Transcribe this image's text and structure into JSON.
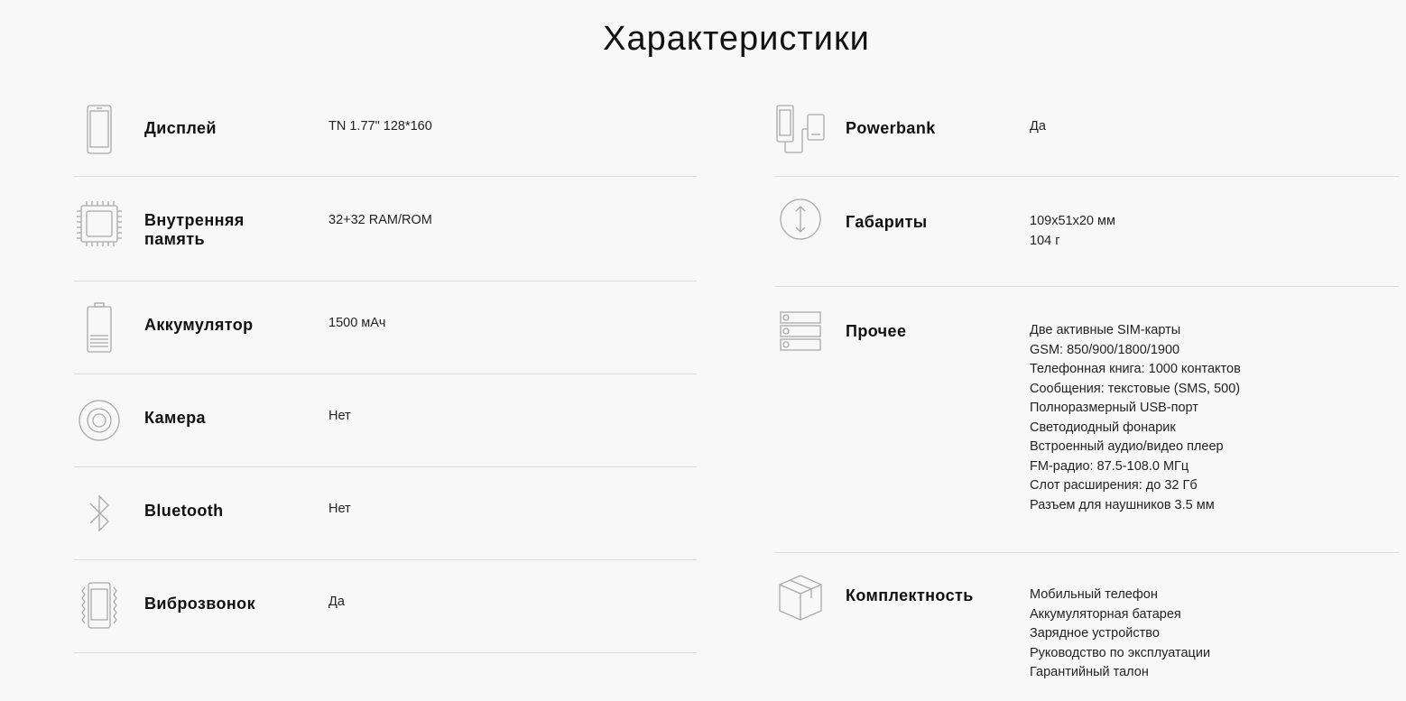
{
  "page": {
    "title": "Характеристики"
  },
  "left_specs": [
    {
      "icon": "phone-icon",
      "label": "Дисплей",
      "lines": [
        "TN 1.77\" 128*160"
      ]
    },
    {
      "icon": "chip-icon",
      "label": "Внутренняя память",
      "lines": [
        "32+32 RAM/ROM"
      ]
    },
    {
      "icon": "battery-icon",
      "label": "Аккумулятор",
      "lines": [
        "1500 мАч"
      ]
    },
    {
      "icon": "camera-lens-icon",
      "label": "Камера",
      "lines": [
        "Нет"
      ]
    },
    {
      "icon": "bluetooth-icon",
      "label": "Bluetooth",
      "lines": [
        "Нет"
      ]
    },
    {
      "icon": "vibration-icon",
      "label": "Виброзвонок",
      "lines": [
        "Да"
      ]
    }
  ],
  "right_specs": [
    {
      "icon": "powerbank-icon",
      "label": "Powerbank",
      "lines": [
        "Да"
      ]
    },
    {
      "icon": "dimensions-icon",
      "label": "Габариты",
      "lines": [
        "109x51x20 мм",
        "104 г"
      ]
    },
    {
      "icon": "server-stack-icon",
      "label": "Прочее",
      "lines": [
        "Две активные SIM-карты",
        "GSM: 850/900/1800/1900",
        "Телефонная книга: 1000 контактов",
        "Сообщения: текстовые (SMS, 500)",
        "Полноразмерный USB-порт",
        "Светодиодный фонарик",
        "Встроенный аудио/видео плеер",
        "FM-радио: 87.5-108.0 МГц",
        "Слот расширения: до 32 Гб",
        "Разъем для наушников 3.5 мм"
      ]
    },
    {
      "icon": "box-icon",
      "label": "Комплектность",
      "lines": [
        "Мобильный телефон",
        "Аккумуляторная батарея",
        "Зарядное устройство",
        "Руководство по эксплуатации",
        "Гарантийный талон"
      ]
    }
  ]
}
